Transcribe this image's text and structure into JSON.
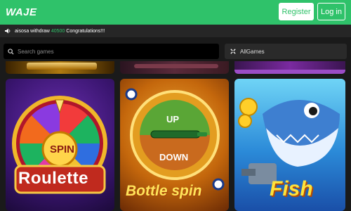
{
  "header": {
    "logo": "WAJE",
    "register_label": "Register",
    "login_label": "Log in"
  },
  "marquee": {
    "user": "aisosa withdraw",
    "amount": "40500",
    "message": "Congratulations!!!"
  },
  "search": {
    "placeholder": "Search games"
  },
  "filter": {
    "selected": "AllGames"
  },
  "games": [
    {
      "title": "Roulette",
      "center_text": "SPIN"
    },
    {
      "title": "Bottle spin",
      "up_label": "UP",
      "down_label": "DOWN"
    },
    {
      "title": "Fish"
    }
  ],
  "colors": {
    "brand": "#2fc26a",
    "amount": "#2fc26a"
  }
}
